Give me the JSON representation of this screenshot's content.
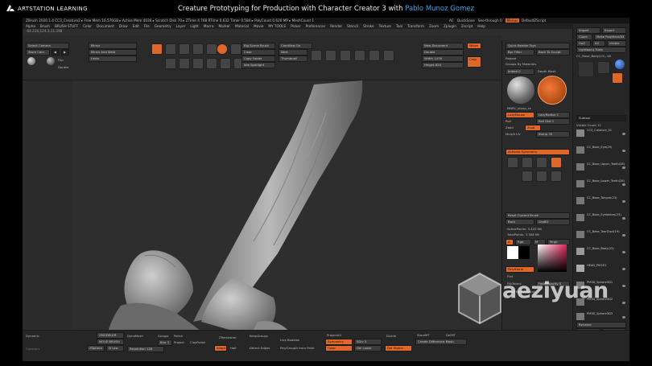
{
  "header": {
    "logo_text": "ARTSTATION LEARNING",
    "course_title": "Creature Prototyping for Production with Character Creator 3",
    "author_prefix": " with ",
    "author": "Pablo Munoz Gomez"
  },
  "zbrush": {
    "info_bar": "ZBrush 2020.1.4    CC3_Creature2 ▸ Free Mem 16.576GB ▸ Active Mem 4036 ▸ Scratch Disk 70 ▸ ZTime 4.768 RTime 0.632 Timer 0.584 ▸ PolyCount 0.620 MP ▸ MeshCount 1",
    "info_right": [
      "AC",
      "QuickSave",
      "See-through 0",
      "Menus",
      "DefaultZScript"
    ],
    "menus": [
      "Alpha",
      "Brush",
      "BRUSH STUFF",
      "Color",
      "Document",
      "Draw",
      "Edit",
      "File",
      "Geometry",
      "Layer",
      "Light",
      "Macro",
      "Marker",
      "Material",
      "Movie",
      "MY TOOLS",
      "Picker",
      "Preferences",
      "Render",
      "Stencil",
      "Stroke",
      "Texture",
      "Tool",
      "Transform",
      "Zoom",
      "Zplugin",
      "Zscript",
      "Help"
    ],
    "coords": "-64.234,124.3,11.298",
    "left_controls": {
      "select_camera": "Select Camera",
      "store_cam": "Store Cam",
      "flip": "Flip",
      "double": "Double",
      "mirror": "Mirror",
      "mirror_weld": "Mirror And Weld",
      "undo": "Undo"
    },
    "toolbar_buttons": [
      "Edit",
      "Draw",
      "Move",
      "Scale",
      "Rotate",
      "Mrgb",
      "Rgb",
      "M",
      "Zadd",
      "Zsub",
      "Zcut"
    ],
    "brush_buttons": {
      "big_scene_brush": "Big Scene Brush",
      "clear": "Clear",
      "copy_folder": "Copy Folder",
      "idle_spotlight": "Idle Spotlight",
      "cam_view_on": "CamView On",
      "next": "Next",
      "thumbnail": "Thumbnail",
      "big_scene_2": "Big Scene"
    },
    "document": {
      "new_document": "New Document",
      "double": "Double",
      "width": "Width 1476",
      "height": "Height 820",
      "wsize": "Wsize",
      "crop": "Crop"
    },
    "render_panel": {
      "quick_render": "Quick Render Toys",
      "bpr_filter": "Bpr Filter",
      "repeat": "Repeat",
      "back_to_sculpt": "Back To Sculpt",
      "groups_by_materials": "Groups By Materials",
      "embed": "Imbed 0",
      "depth_mask": "Depth Mask",
      "materials_label": "MNRC_sharp_cs",
      "lazymouse": "LazyMouse",
      "lazyradius": "LazyRadius 1",
      "roll": "Roll",
      "roll_dist": "Roll Dist 1",
      "zadd": "Zadd",
      "zsub": "Zsub",
      "morph_uv": "Morph UV",
      "bump": "Bump 30",
      "activate_symmetry": "Activate Symmetry",
      "reset_current_brush": "Reset Current Brush",
      "back": "Back",
      "grp_bg": "GrpBG",
      "active_points": "ActivePoints: 3.420 Mil",
      "total_points": "TotalPoints: 3.308 Mil",
      "a": "A",
      "rgb": "Rgb",
      "m": "M",
      "mrgb": "Mrgb",
      "polyframe": "Polyframe",
      "flat": "Flat",
      "fill_object": "FillObject",
      "fade_opacity": "Fade Opacity 0",
      "mask_by_polypaint": "Mask By Polypaint",
      "lightbox": "LightBox",
      "quick_sketch": "Quick Sketch"
    },
    "tool_panel": {
      "import": "Import",
      "export": "Export",
      "clone": "Clone",
      "make_polymesh": "Make PolyMesh3D",
      "goz": "GoZ",
      "all": "All",
      "visible": "Visible",
      "lightbox_tools": "Lightbox ▸ Tools",
      "current_tool": "CC_Base_Body(23), 48",
      "subtool_header": "Subtool",
      "visible_count": "Visible Count 11",
      "subtools": [
        "CC3_Creature_01",
        "CC_Base_Eye(29)",
        "CC_Base_Upper_Teeth(28)",
        "CC_Base_Lower_Teeth(28)",
        "CC_Base_Tongue(23)",
        "CC_Base_Eyelashes(25)",
        "CC_Base_TearDuct(19)",
        "CC_Base_Body(23)",
        "HEAD_PIECE1",
        "PM3D_Sphere3D1",
        "PM3D_Sphere3D2",
        "PM3D_Sphere3D3"
      ],
      "rename": "Rename",
      "all_low": "All Low",
      "all_high": "All High",
      "copy": "Copy",
      "paste": "Paste",
      "duplicate": "Duplicate",
      "append": "Append",
      "insert": "Insert",
      "del_other": "Del Other"
    },
    "bottom": {
      "dynamic": "Dynamic",
      "constant": "Constant",
      "zmodeler": "ZMODELER",
      "move_brush": "MOVE BRUSH",
      "zsphere": "ZSphere",
      "dlow": "D Low",
      "dynamesh": "DynaMesh",
      "resolution": "Resolution 128",
      "groups": "Groups",
      "polish": "Polish",
      "blur": "Blur 2",
      "project": "Project",
      "clay_polish": "ClayPolish",
      "zremesher": "ZRemesher",
      "half": "Half",
      "adapt": "Adapt",
      "keep_groups": "KeepGroups",
      "detect_edges": "Detect Edges",
      "live_boolean": "Live Boolean",
      "polygroup_from_paint": "PolyGroupIt from Paint",
      "project_all": "ProjectAll",
      "symmetry": "Symmetry",
      "sdiv": "SDiv 5",
      "color": "Color",
      "del_lower": "Del Lower",
      "divide": "Divide",
      "del_higher": "Del Higher",
      "store_mt": "StoreMT",
      "del_mt": "DelMT",
      "create_difference_mesh": "Create Difference Mesh"
    }
  },
  "watermark": "aeziyuan",
  "colors": {
    "accent_orange": "#e0672a",
    "author_blue": "#3ea6e8",
    "ui_dark": "#2e2e2e"
  }
}
